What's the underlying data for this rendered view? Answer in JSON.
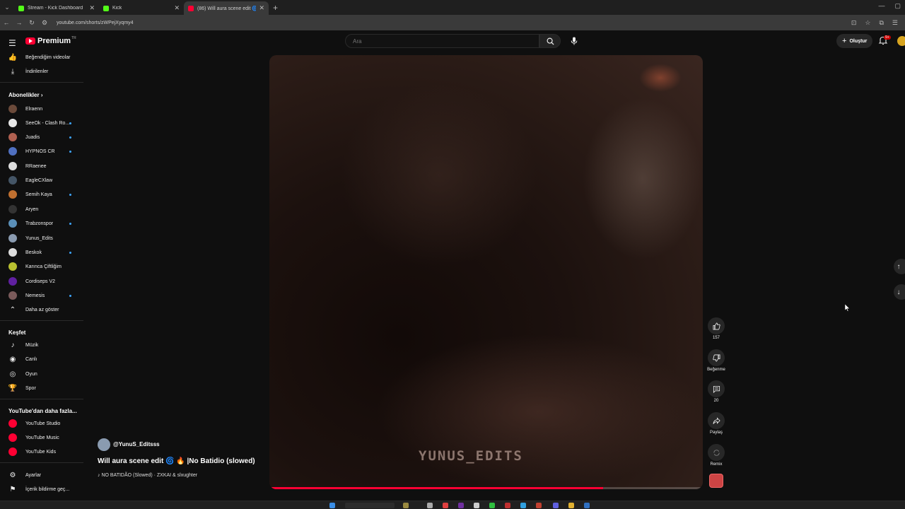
{
  "browser": {
    "tabs": [
      {
        "title": "Stream - Kick Dashboard",
        "favicon": "kick-icon"
      },
      {
        "title": "Kick",
        "favicon": "kick-icon"
      },
      {
        "title": "(86) Will aura scene edit 🌀",
        "favicon": "youtube-icon"
      }
    ],
    "url": "youtube.com/shorts/zWPejXyqmy4"
  },
  "header": {
    "logo_text": "Premium",
    "logo_tm": "TR",
    "search_placeholder": "Ara",
    "create_label": "Oluştur",
    "notifications_badge": "9+"
  },
  "sidebar": {
    "top_items": [
      {
        "label": "Beğendiğim videolar",
        "icon": "thumbs-up-icon"
      },
      {
        "label": "İndirilenler",
        "icon": "download-icon"
      }
    ],
    "subscriptions_heading": "Abonelikler",
    "subscriptions": [
      {
        "label": "Elraenn",
        "color": "#6b4a3a",
        "new": false
      },
      {
        "label": "SeeOk - Clash Ro...",
        "color": "#e8e8e8",
        "new": true
      },
      {
        "label": "Juadis",
        "color": "#b06050",
        "new": true
      },
      {
        "label": "HYPNOS CR",
        "color": "#5070c0",
        "new": true
      },
      {
        "label": "RRaenee",
        "color": "#dddddd",
        "new": false
      },
      {
        "label": "EagleCXlaw",
        "color": "#445566",
        "new": false
      },
      {
        "label": "Semih Kaya",
        "color": "#c07030",
        "new": true
      },
      {
        "label": "Aryen",
        "color": "#333333",
        "new": false
      },
      {
        "label": "Trabzonspor",
        "color": "#5a8fb8",
        "new": true
      },
      {
        "label": "Yunus_Edits",
        "color": "#8a9bb0",
        "new": false
      },
      {
        "label": "Beskok",
        "color": "#dddddd",
        "new": true
      },
      {
        "label": "Karınca Çiftliğim",
        "color": "#b8c030",
        "new": false
      },
      {
        "label": "Cordiseps V2",
        "color": "#6020a0",
        "new": false
      },
      {
        "label": "Nemesis",
        "color": "#7a5a5a",
        "new": true
      }
    ],
    "show_less": "Daha az göster",
    "explore_heading": "Keşfet",
    "explore": [
      {
        "label": "Müzik",
        "icon": "music-note-icon"
      },
      {
        "label": "Canlı",
        "icon": "live-icon"
      },
      {
        "label": "Oyun",
        "icon": "gamepad-icon"
      },
      {
        "label": "Spor",
        "icon": "trophy-icon"
      }
    ],
    "more_heading": "YouTube'dan daha fazla...",
    "more": [
      {
        "label": "YouTube Studio"
      },
      {
        "label": "YouTube Music"
      },
      {
        "label": "YouTube Kids"
      }
    ],
    "bottom": [
      {
        "label": "Ayarlar",
        "icon": "gear-icon"
      },
      {
        "label": "İçerik bildirme geç...",
        "icon": "flag-icon"
      }
    ]
  },
  "video": {
    "watermark": "YUNUS_EDITS",
    "progress": 0.77,
    "channel": "@YunuS_Editsss",
    "title": "Will aura scene edit 🌀 🔥 |No Batidio (slowed)",
    "music": "♪ NO BATIDÃO (Slowed) · ZXKAI & slxughter"
  },
  "actions": {
    "like_count": "157",
    "dislike_label": "Beğenme",
    "comment_count": "20",
    "share_label": "Paylaş",
    "remix_label": "Remix"
  },
  "colors": {
    "accent": "#ff0033",
    "background": "#0f0f0f"
  }
}
